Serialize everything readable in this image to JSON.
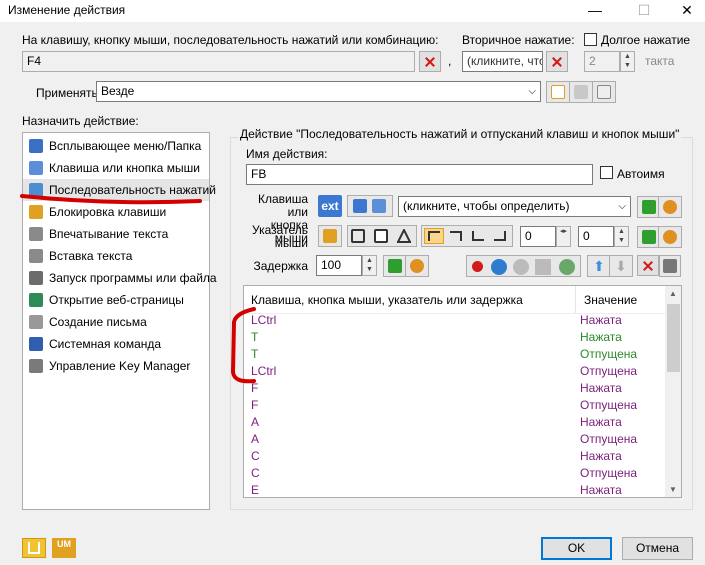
{
  "window": {
    "title": "Изменение действия",
    "min": "—",
    "max": "☐",
    "close": "✕"
  },
  "trigger": {
    "label": "На клавишу, кнопку мыши, последовательность нажатий или комбинацию:",
    "value": "F4",
    "comma": ",",
    "secondary_label": "Вторичное нажатие:",
    "secondary_value": "(кликните, что",
    "long_press_label": "Долгое нажатие",
    "long_press_value": "2",
    "tact_label": "такта"
  },
  "apply": {
    "label": "Применять",
    "value": "Везде"
  },
  "assign": {
    "label": "Назначить действие:",
    "items": [
      {
        "label": "Всплывающее меню/Папка",
        "icon": "popup-menu-icon",
        "color": "#3a6fc4"
      },
      {
        "label": "Клавиша или кнопка мыши",
        "icon": "key-mouse-icon",
        "color": "#5b8fd8"
      },
      {
        "label": "Последовательность нажатий",
        "icon": "key-sequence-icon",
        "color": "#4b8fd0",
        "selected": true
      },
      {
        "label": "Блокировка клавиши",
        "icon": "key-lock-icon",
        "color": "#e0a020"
      },
      {
        "label": "Впечатывание текста",
        "icon": "type-text-icon",
        "color": "#8a8a8a"
      },
      {
        "label": "Вставка текста",
        "icon": "paste-text-icon",
        "color": "#8a8a8a"
      },
      {
        "label": "Запуск программы или файла",
        "icon": "run-program-icon",
        "color": "#6c6c6c"
      },
      {
        "label": "Открытие веб-страницы",
        "icon": "web-page-icon",
        "color": "#2e8b57"
      },
      {
        "label": "Создание письма",
        "icon": "email-icon",
        "color": "#999999"
      },
      {
        "label": "Системная команда",
        "icon": "system-command-icon",
        "color": "#2f5fae"
      },
      {
        "label": "Управление Key Manager",
        "icon": "key-manager-icon",
        "color": "#7a7a7a"
      }
    ]
  },
  "action": {
    "group_title": "Действие \"Последовательность нажатий и отпусканий клавиш и кнопок мыши\"",
    "name_label": "Имя действия:",
    "name_value": "FB",
    "autoname_label": "Автоимя",
    "key_label_1": "Клавиша или",
    "key_label_2": "кнопка мыши",
    "ext_label": "ext",
    "key_value": "(кликните, чтобы определить)",
    "pointer_label_1": "Указатель",
    "pointer_label_2": "мыши",
    "pointer_x": "0",
    "pointer_y": "0",
    "delay_label": "Задержка",
    "delay_value": "100"
  },
  "grid": {
    "col_key": "Клавиша, кнопка мыши, указатель или задержка",
    "col_value": "Значение",
    "rows": [
      {
        "key": "LCtrl",
        "value": "Нажата"
      },
      {
        "key": "T",
        "value": "Нажата"
      },
      {
        "key": "T",
        "value": "Отпущена"
      },
      {
        "key": "LCtrl",
        "value": "Отпущена"
      },
      {
        "key": "F",
        "value": "Нажата"
      },
      {
        "key": "F",
        "value": "Отпущена"
      },
      {
        "key": "A",
        "value": "Нажата"
      },
      {
        "key": "A",
        "value": "Отпущена"
      },
      {
        "key": "C",
        "value": "Нажата"
      },
      {
        "key": "C",
        "value": "Отпущена"
      },
      {
        "key": "E",
        "value": "Нажата"
      }
    ]
  },
  "buttons": {
    "ok": "OK",
    "cancel": "Отмена",
    "um": "UM"
  },
  "colors": {
    "pressed": "#7a1f7a",
    "released": "#7a1f7a",
    "accent": "#0078d7",
    "annotation": "#d40000"
  }
}
